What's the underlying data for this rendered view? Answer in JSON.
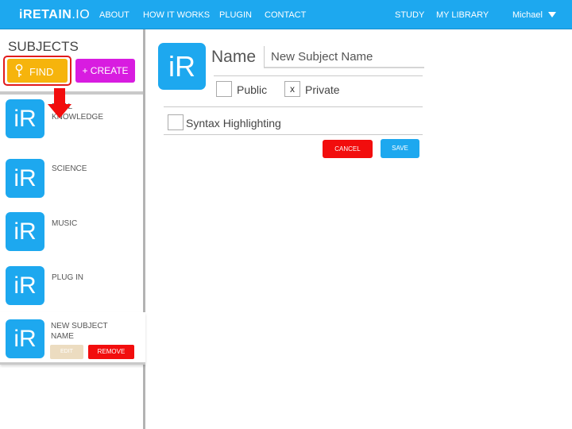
{
  "header": {
    "logo_main": "iRETAIN",
    "logo_suffix": ".IO",
    "nav": [
      "ABOUT",
      "HOW IT WORKS",
      "PLUGIN",
      "CONTACT"
    ],
    "right_nav": [
      "STUDY",
      "MY LIBRARY"
    ],
    "user": "Michael"
  },
  "sidebar": {
    "title": "SUBJECTS",
    "find_label": "FIND",
    "create_label": "+ CREATE",
    "items": [
      {
        "tile": "iR",
        "label": "GENERAL\nKNOWLEDGE",
        "visible_label": "ERAL\nKNOWLEDGE"
      },
      {
        "tile": "iR",
        "label": "SCIENCE"
      },
      {
        "tile": "iR",
        "label": "MUSIC"
      },
      {
        "tile": "iR",
        "label": "PLUG IN"
      }
    ],
    "active_item": {
      "tile": "iR",
      "label": "NEW SUBJECT\nNAME",
      "edit_label": "EDIT",
      "remove_label": "REMOVE"
    }
  },
  "form": {
    "tile": "iR",
    "name_label": "Name",
    "name_value": "New Subject Name",
    "public_label": "Public",
    "public_checked": "",
    "private_label": "Private",
    "private_checked": "x",
    "syntax_label": "Syntax Highlighting",
    "syntax_checked": "",
    "cancel_label": "CANCEL",
    "save_label": "SAVE"
  },
  "colors": {
    "brand_blue": "#1da8ef",
    "find_yellow": "#f6b40c",
    "create_magenta": "#d81ce0",
    "danger_red": "#f20d0d",
    "highlight_red": "#e21b1b"
  }
}
